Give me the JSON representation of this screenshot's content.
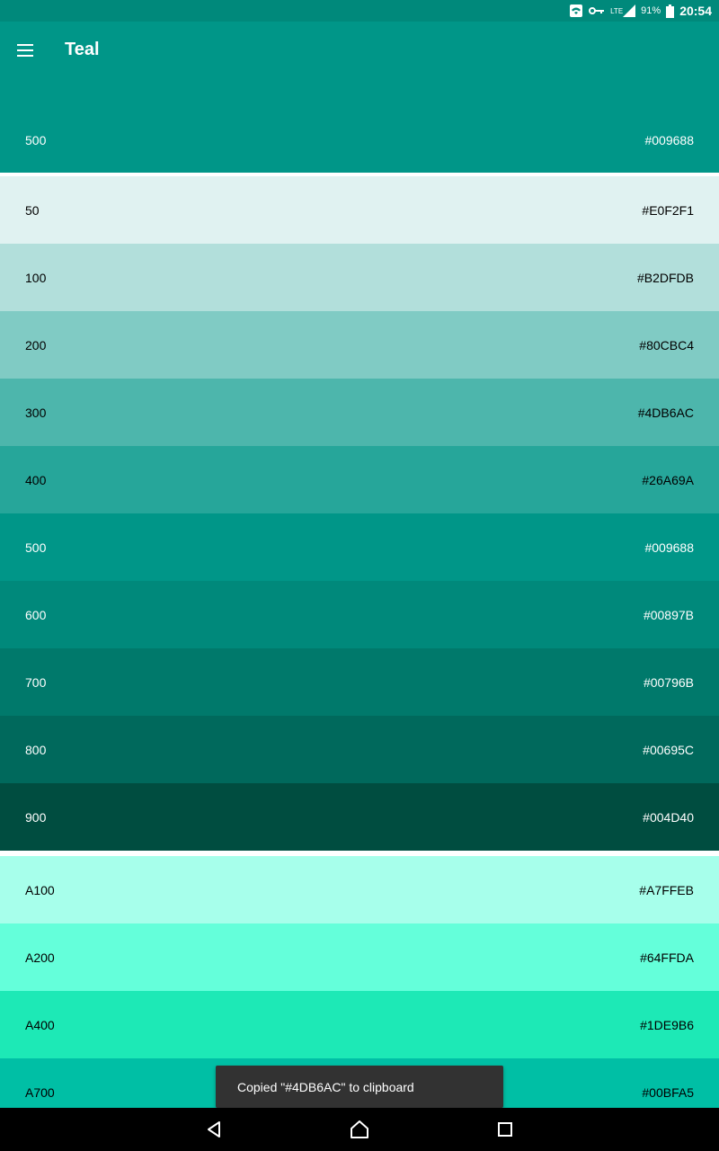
{
  "status_bar": {
    "lte": "LTE",
    "battery": "91%",
    "time": "20:54",
    "icons": [
      "wifi-icon",
      "vpn-key-icon",
      "signal-icon",
      "battery-icon"
    ]
  },
  "app_bar": {
    "title": "Teal",
    "primary": {
      "name": "500",
      "hex": "#009688"
    }
  },
  "swatches_main": [
    {
      "name": "50",
      "hex": "#E0F2F1",
      "text_color": "#000000"
    },
    {
      "name": "100",
      "hex": "#B2DFDB",
      "text_color": "#000000"
    },
    {
      "name": "200",
      "hex": "#80CBC4",
      "text_color": "#000000"
    },
    {
      "name": "300",
      "hex": "#4DB6AC",
      "text_color": "#000000"
    },
    {
      "name": "400",
      "hex": "#26A69A",
      "text_color": "#000000"
    },
    {
      "name": "500",
      "hex": "#009688",
      "text_color": "#ffffff"
    },
    {
      "name": "600",
      "hex": "#00897B",
      "text_color": "#ffffff"
    },
    {
      "name": "700",
      "hex": "#00796B",
      "text_color": "#ffffff"
    },
    {
      "name": "800",
      "hex": "#00695C",
      "text_color": "#ffffff"
    },
    {
      "name": "900",
      "hex": "#004D40",
      "text_color": "#ffffff"
    }
  ],
  "swatches_accent": [
    {
      "name": "A100",
      "hex": "#A7FFEB",
      "text_color": "#000000"
    },
    {
      "name": "A200",
      "hex": "#64FFDA",
      "text_color": "#000000"
    },
    {
      "name": "A400",
      "hex": "#1DE9B6",
      "text_color": "#000000"
    },
    {
      "name": "A700",
      "hex": "#00BFA5",
      "text_color": "#000000"
    }
  ],
  "snackbar": {
    "message": "Copied \"#4DB6AC\" to clipboard"
  },
  "nav": {
    "icons": [
      "back-icon",
      "home-icon",
      "recents-icon"
    ]
  }
}
